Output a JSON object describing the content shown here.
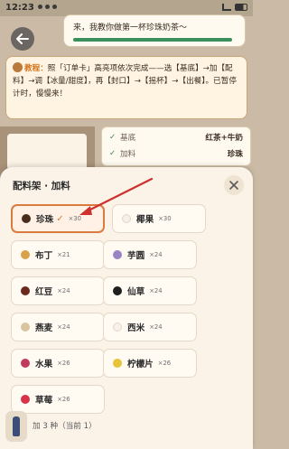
{
  "status_bar": {
    "time": "12:23"
  },
  "speech": {
    "text": "来，我教你做第一杯珍珠奶茶～",
    "progress": 1.0,
    "progress_color": "#3a8f5c"
  },
  "tutorial": {
    "label": "教程：",
    "body": "照「订单卡」高亮项依次完成——选【基底】→加【配料】→调【冰量/甜度】，再【封口】→【摇杯】→【出餐】。已暂停计时，慢慢来！"
  },
  "recipe": [
    {
      "label": "基底",
      "value": "红茶+牛奶"
    },
    {
      "label": "加料",
      "value": "珍珠"
    }
  ],
  "sheet": {
    "title": "配料架 · 加料",
    "footer": "加 3 种（当前 1）",
    "toppings": [
      {
        "name": "珍珠",
        "count": "×30",
        "color": "#4a2c1d",
        "selected": true,
        "check": "✓"
      },
      {
        "name": "椰果",
        "count": "×30",
        "color": "#f4efe7",
        "selected": false
      },
      {
        "name": "布丁",
        "count": "×21",
        "color": "#d9a24a",
        "selected": false
      },
      {
        "name": "芋圆",
        "count": "×24",
        "color": "#9a83c4",
        "selected": false
      },
      {
        "name": "红豆",
        "count": "×24",
        "color": "#6b2a1e",
        "selected": false
      },
      {
        "name": "仙草",
        "count": "×24",
        "color": "#1f1f1f",
        "selected": false
      },
      {
        "name": "燕麦",
        "count": "×24",
        "color": "#d9c4a0",
        "selected": false
      },
      {
        "name": "西米",
        "count": "×24",
        "color": "#f6f1ea",
        "selected": false
      },
      {
        "name": "水果",
        "count": "×26",
        "color": "#c23a5e",
        "selected": false
      },
      {
        "name": "柠檬片",
        "count": "×26",
        "color": "#e8c43a",
        "selected": false
      },
      {
        "name": "草莓",
        "count": "×26",
        "color": "#d9314a",
        "selected": false
      }
    ]
  },
  "colors": {
    "accent": "#d97a3e",
    "sheet_bg": "#fbf3e8",
    "arrow": "#d0312d"
  },
  "icons": {
    "back": "arrow-left-icon",
    "close": "close-icon",
    "cup": "cup-icon"
  }
}
